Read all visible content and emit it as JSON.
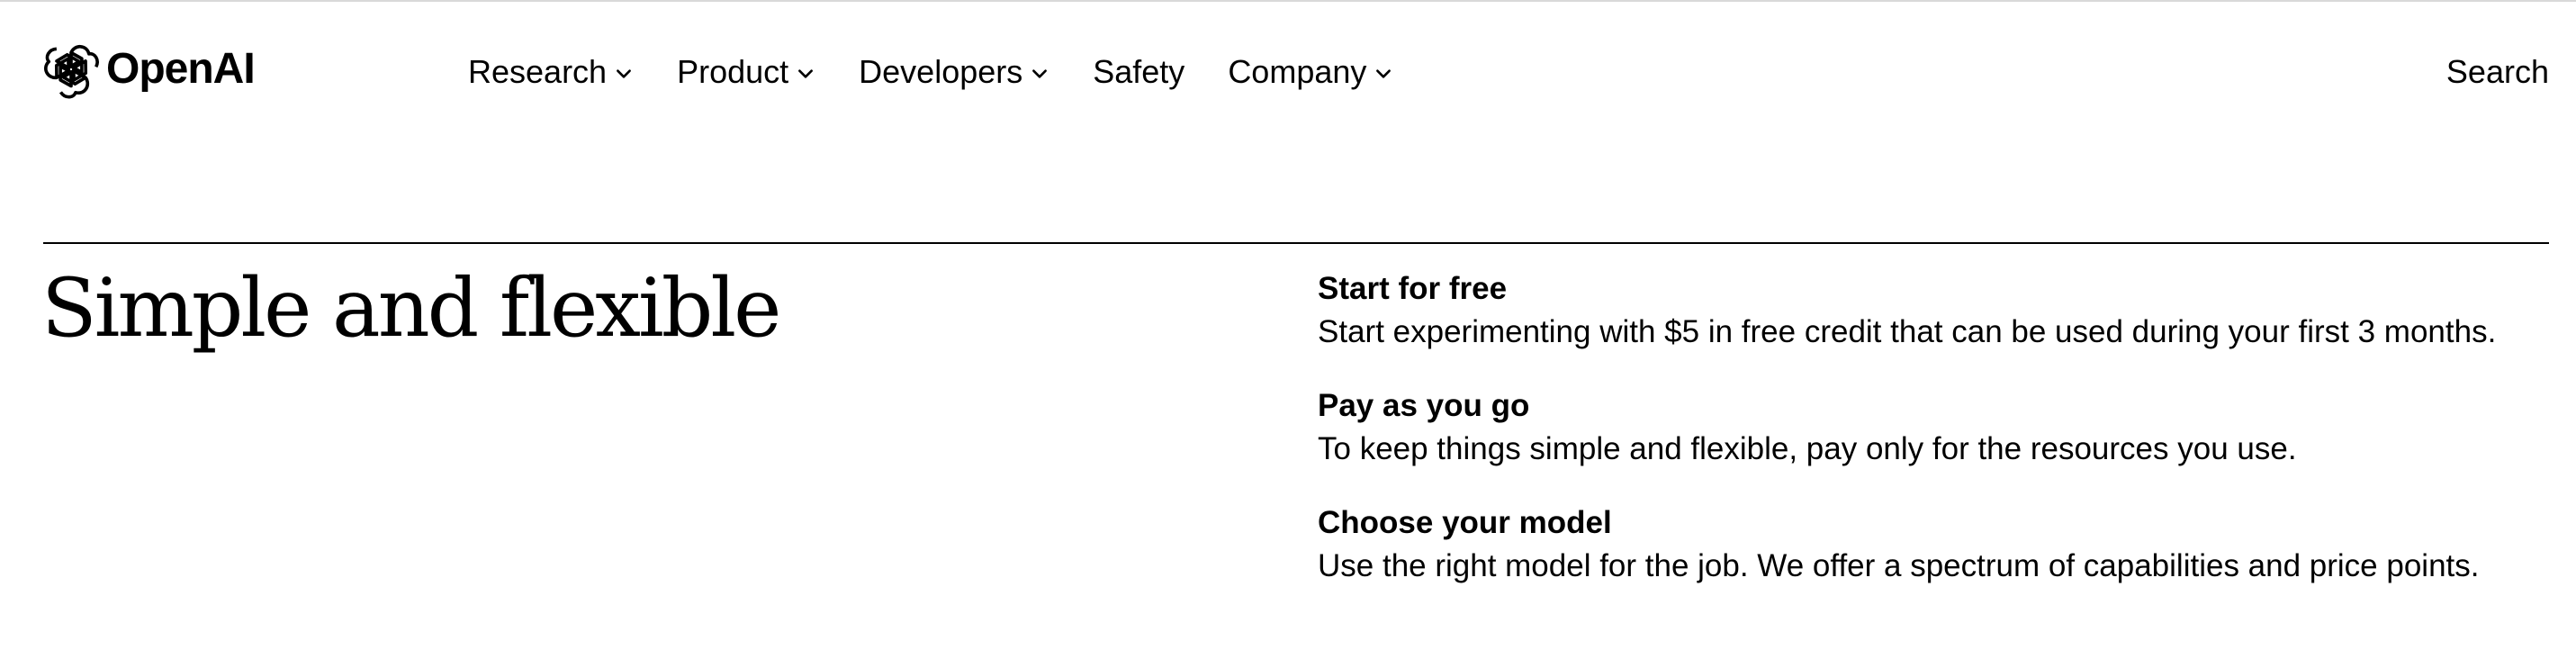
{
  "brand": {
    "name": "OpenAI",
    "logo_icon": "openai-blossom-icon"
  },
  "nav": {
    "items": [
      {
        "label": "Research",
        "has_dropdown": true
      },
      {
        "label": "Product",
        "has_dropdown": true
      },
      {
        "label": "Developers",
        "has_dropdown": true
      },
      {
        "label": "Safety",
        "has_dropdown": false
      },
      {
        "label": "Company",
        "has_dropdown": true
      }
    ],
    "search_label": "Search"
  },
  "hero": {
    "title": "Simple and flexible"
  },
  "features": [
    {
      "title": "Start for free",
      "description": "Start experimenting with $5 in free credit that can be used during your first 3 months."
    },
    {
      "title": "Pay as you go",
      "description": "To keep things simple and flexible, pay only for the resources you use."
    },
    {
      "title": "Choose your model",
      "description": "Use the right model for the job. We offer a spectrum of capabilities and price points."
    }
  ],
  "colors": {
    "text": "#000000",
    "background": "#ffffff",
    "divider": "#000000"
  }
}
